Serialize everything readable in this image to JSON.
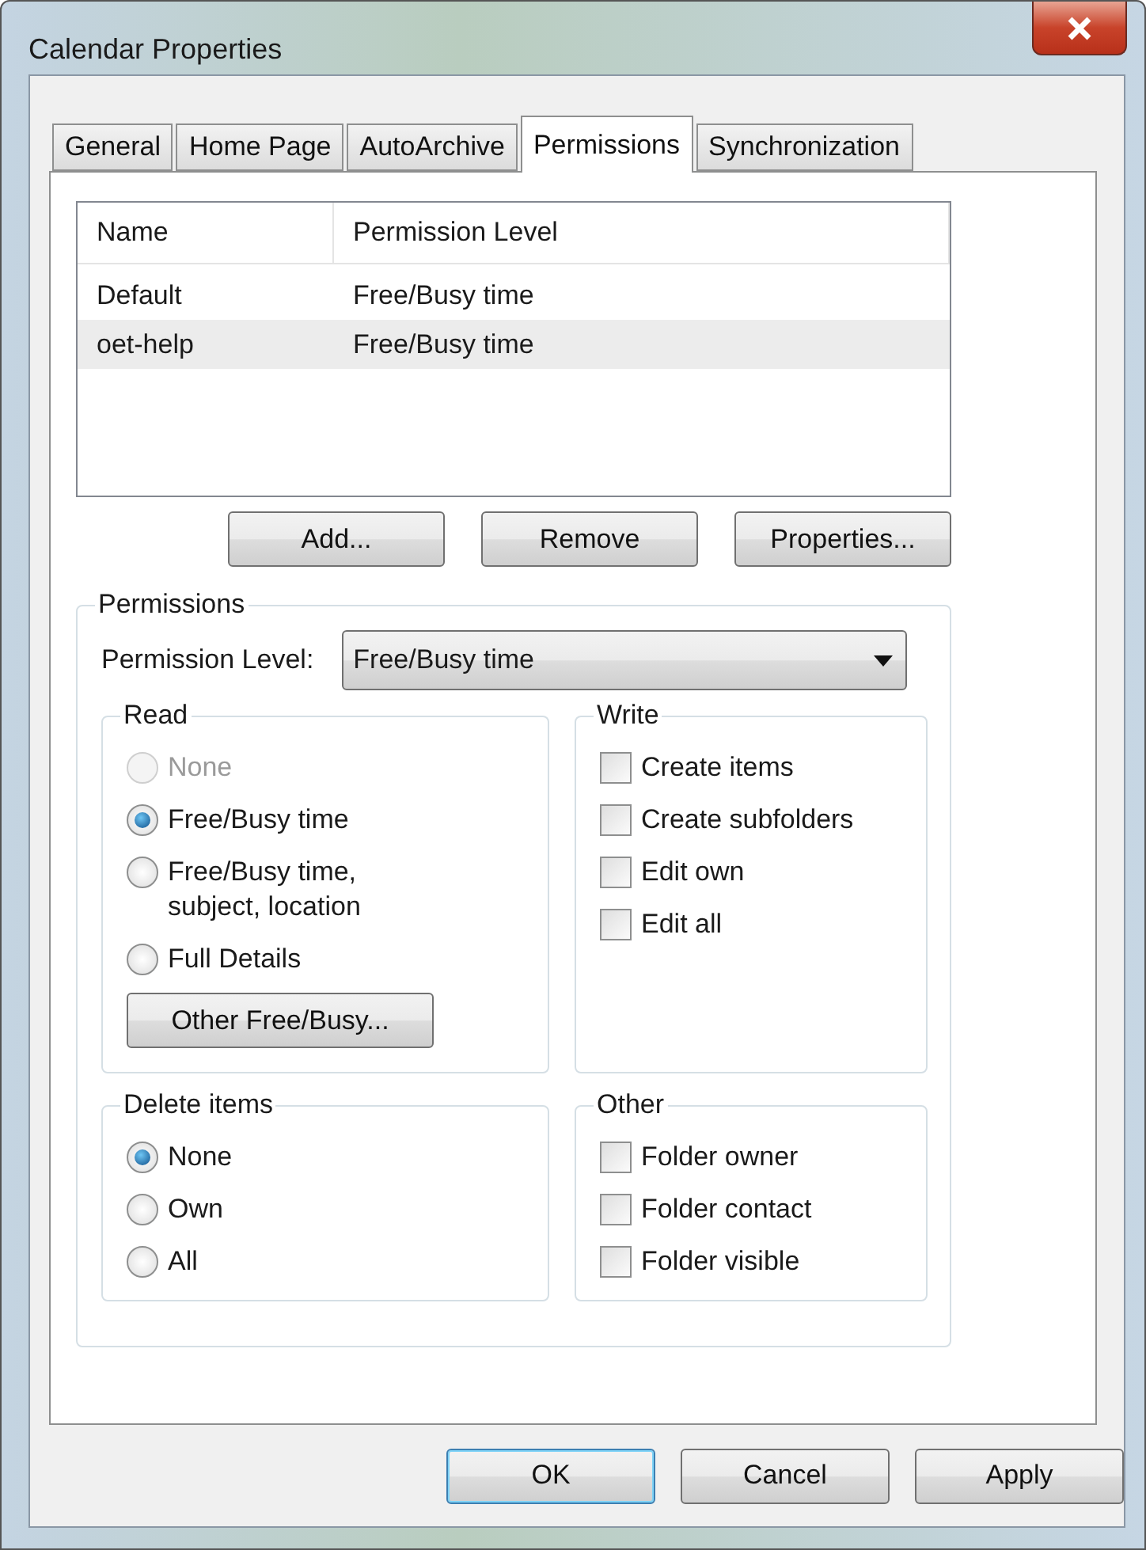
{
  "window": {
    "title": "Calendar Properties"
  },
  "tabs": [
    {
      "label": "General",
      "selected": false
    },
    {
      "label": "Home Page",
      "selected": false
    },
    {
      "label": "AutoArchive",
      "selected": false
    },
    {
      "label": "Permissions",
      "selected": true
    },
    {
      "label": "Synchronization",
      "selected": false
    }
  ],
  "permission_list": {
    "columns": [
      "Name",
      "Permission Level"
    ],
    "rows": [
      {
        "cells": [
          "Default",
          "Free/Busy time"
        ],
        "selected": false
      },
      {
        "cells": [
          "oet-help",
          "Free/Busy time"
        ],
        "selected": true
      }
    ]
  },
  "list_buttons": [
    "Add...",
    "Remove",
    "Properties..."
  ],
  "permissions": {
    "title": "Permissions",
    "level_label": "Permission Level:",
    "level_value": "Free/Busy time",
    "read": {
      "title": "Read",
      "kind": "radio",
      "options": [
        {
          "label": "None",
          "selected": false,
          "disabled": true
        },
        {
          "label": "Free/Busy time",
          "selected": true,
          "disabled": false
        },
        {
          "label": "Free/Busy time, subject, location",
          "selected": false,
          "disabled": false
        },
        {
          "label": "Full Details",
          "selected": false,
          "disabled": false
        }
      ],
      "button": "Other Free/Busy..."
    },
    "write": {
      "title": "Write",
      "kind": "checkbox",
      "options": [
        {
          "label": "Create items",
          "checked": false
        },
        {
          "label": "Create subfolders",
          "checked": false
        },
        {
          "label": "Edit own",
          "checked": false
        },
        {
          "label": "Edit all",
          "checked": false
        }
      ]
    },
    "delete_items": {
      "title": "Delete items",
      "kind": "radio",
      "options": [
        {
          "label": "None",
          "selected": true,
          "disabled": false
        },
        {
          "label": "Own",
          "selected": false,
          "disabled": false
        },
        {
          "label": "All",
          "selected": false,
          "disabled": false
        }
      ]
    },
    "other": {
      "title": "Other",
      "kind": "checkbox",
      "options": [
        {
          "label": "Folder owner",
          "checked": false
        },
        {
          "label": "Folder contact",
          "checked": false
        },
        {
          "label": "Folder visible",
          "checked": false
        }
      ]
    }
  },
  "buttons": [
    {
      "label": "OK",
      "default": true
    },
    {
      "label": "Cancel",
      "default": false
    },
    {
      "label": "Apply",
      "default": false
    }
  ]
}
